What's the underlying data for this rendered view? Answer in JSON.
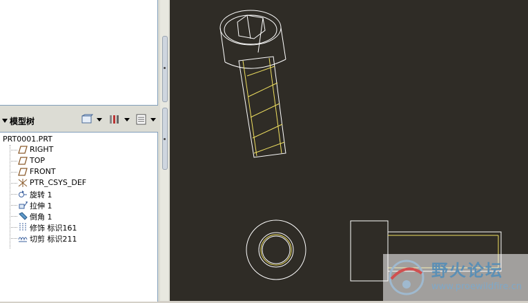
{
  "model_tree": {
    "title": "模型树",
    "root": "PRT0001.PRT",
    "items": [
      {
        "label": "RIGHT",
        "icon": "datum-plane-icon"
      },
      {
        "label": "TOP",
        "icon": "datum-plane-icon"
      },
      {
        "label": "FRONT",
        "icon": "datum-plane-icon"
      },
      {
        "label": "PTR_CSYS_DEF",
        "icon": "csys-icon"
      },
      {
        "label": "旋转 1",
        "icon": "revolve-icon"
      },
      {
        "label": "拉伸 1",
        "icon": "extrude-icon"
      },
      {
        "label": "倒角 1",
        "icon": "chamfer-icon"
      },
      {
        "label": "修饰 标识161",
        "icon": "cosmetic-icon"
      },
      {
        "label": "切剪 标识211",
        "icon": "cut-icon"
      }
    ]
  },
  "watermark": {
    "title": "野火论坛",
    "url": "www.proewildfire.cn"
  },
  "colors": {
    "viewport_bg": "#2f2c26",
    "geometry": "#ffffff",
    "thread": "#f0e060"
  }
}
